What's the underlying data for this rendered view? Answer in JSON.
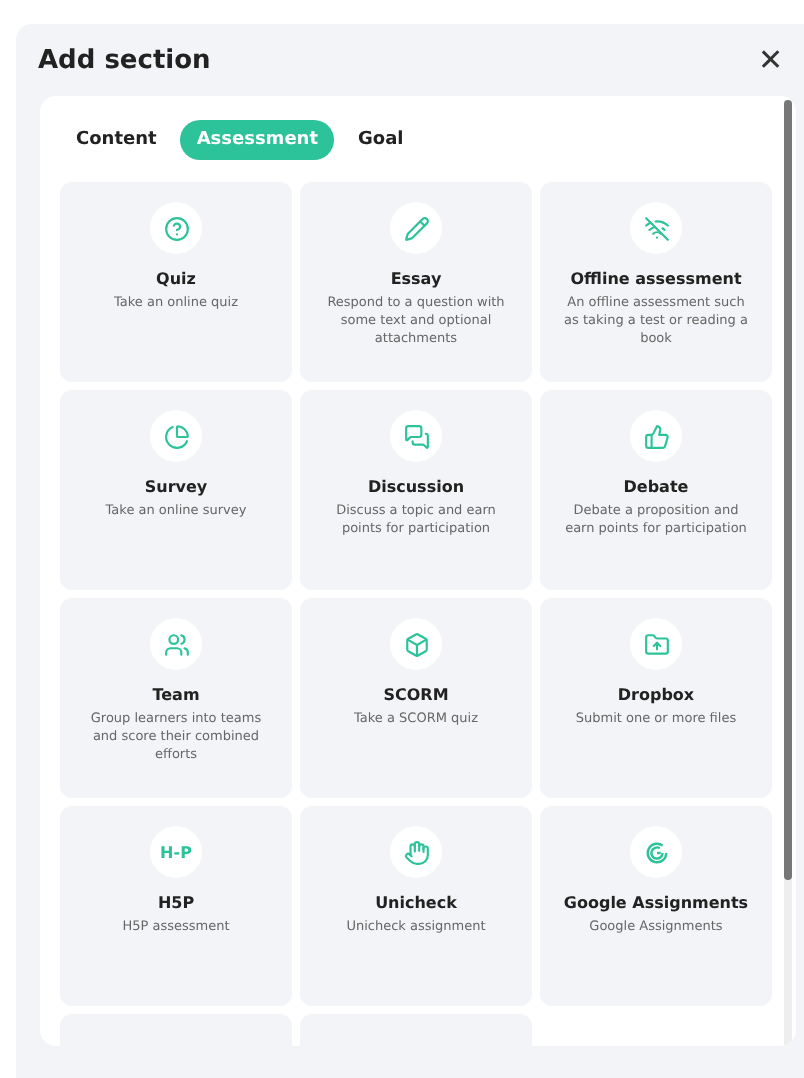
{
  "dialog": {
    "title": "Add section",
    "close": "✕"
  },
  "tabs": [
    {
      "label": "Content",
      "selected": false
    },
    {
      "label": "Assessment",
      "selected": true
    },
    {
      "label": "Goal",
      "selected": false
    }
  ],
  "items": [
    {
      "title": "Quiz",
      "description": "Take an online quiz"
    },
    {
      "title": "Essay",
      "description": "Respond to a question with some text and optional attachments"
    },
    {
      "title": "Offline assessment",
      "description": "An offline assessment such as taking a test or reading a book"
    },
    {
      "title": "Survey",
      "description": "Take an online survey"
    },
    {
      "title": "Discussion",
      "description": "Discuss a topic and earn points for participation"
    },
    {
      "title": "Debate",
      "description": "Debate a proposition and earn points for participation"
    },
    {
      "title": "Team",
      "description": "Group learners into teams and score their combined efforts"
    },
    {
      "title": "SCORM",
      "description": "Take a SCORM quiz"
    },
    {
      "title": "Dropbox",
      "description": "Submit one or more files"
    },
    {
      "logo_text": "H-P",
      "title": "H5P",
      "description": "H5P assessment"
    },
    {
      "title": "Unicheck",
      "description": "Unicheck assignment"
    },
    {
      "title": "Google Assignments",
      "description": "Google Assignments"
    }
  ]
}
